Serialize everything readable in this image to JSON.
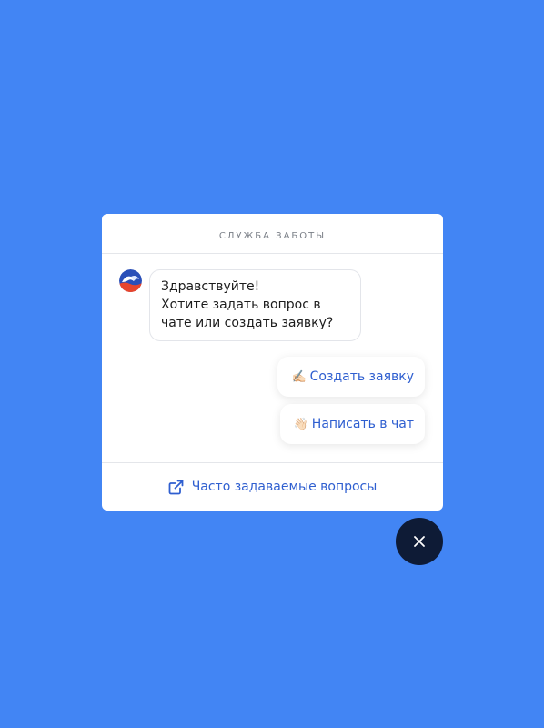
{
  "colors": {
    "background": "#4285f4",
    "link": "#2f5fd0",
    "close_button": "#0e1b36"
  },
  "widget": {
    "title": "СЛУЖБА ЗАБОТЫ",
    "bot_avatar_icon": "wave-logo-avatar",
    "bot_message_lines": [
      "Здравствуйте!",
      "Хотите задать вопрос в",
      "чате или создать заявку?"
    ],
    "quick_replies": [
      {
        "emoji": "✍🏻",
        "emoji_icon": "writing-hand-icon",
        "label": "Создать заявку"
      },
      {
        "emoji": "👋🏻",
        "emoji_icon": "waving-hand-icon",
        "label": "Написать в чат"
      }
    ],
    "footer": {
      "icon": "external-link-icon",
      "label": "Часто задаваемые вопросы"
    }
  },
  "close_button": {
    "icon": "close-icon"
  }
}
